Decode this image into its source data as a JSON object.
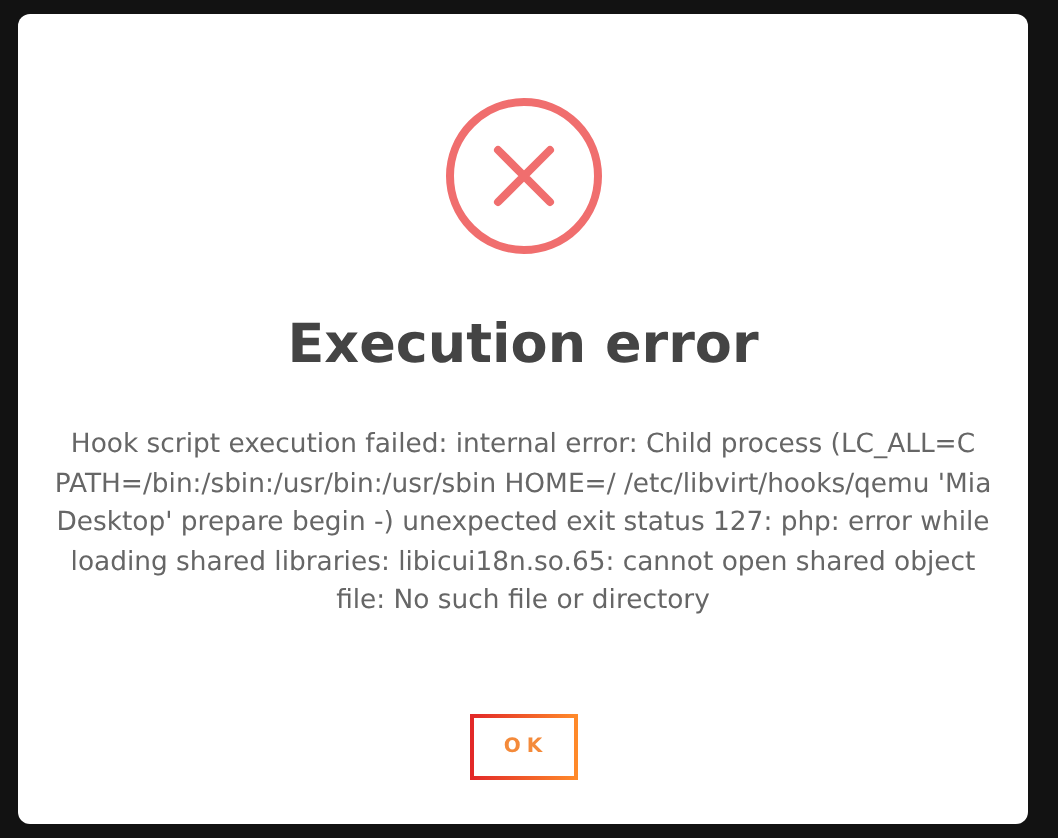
{
  "dialog": {
    "kind": "error",
    "title": "Execution error",
    "message": "Hook script execution failed: internal error: Child process (LC_ALL=C PATH=/bin:/sbin:/usr/bin:/usr/sbin HOME=/ /etc/libvirt/hooks/qemu 'Mia Desktop' prepare begin -) unexpected exit status 127: php: error while loading shared libraries: libicui18n.so.65: cannot open shared object file: No such file or directory",
    "buttons": [
      {
        "label": "OK"
      }
    ]
  }
}
